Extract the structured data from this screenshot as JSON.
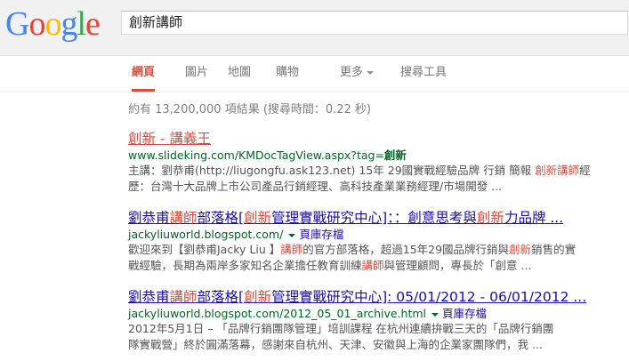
{
  "logo": {
    "letters": [
      {
        "ch": "G",
        "color": "#4285f4"
      },
      {
        "ch": "o",
        "color": "#ea4335"
      },
      {
        "ch": "o",
        "color": "#fbbc05"
      },
      {
        "ch": "g",
        "color": "#4285f4"
      },
      {
        "ch": "l",
        "color": "#34a853"
      },
      {
        "ch": "e",
        "color": "#ea4335"
      }
    ]
  },
  "search": {
    "query": "創新講師"
  },
  "tabs": [
    {
      "label": "網頁",
      "active": true
    },
    {
      "label": "圖片"
    },
    {
      "label": "地圖"
    },
    {
      "label": "購物"
    },
    {
      "label": "更多"
    },
    {
      "label": "搜尋工具"
    }
  ],
  "stats": "約有 13,200,000 項結果 (搜尋時間：0.22 秒)",
  "results": [
    {
      "title_parts": [
        [
          "創新",
          true
        ],
        [
          " - 講義王",
          false
        ]
      ],
      "url_parts": [
        [
          "www.slideking.com/KMDocTagView.aspx?tag=",
          false
        ],
        [
          "創新",
          true
        ]
      ],
      "cache": "",
      "snippet_lines": [
        [
          [
            "主講：劉恭甫(http://liugongfu.ask123.net) 15年 29國實戰經驗品牌 行銷 簡報 ",
            false
          ],
          [
            "創新講師",
            true
          ],
          [
            "經",
            false
          ]
        ],
        [
          [
            "歷：台灣十大品牌上市公司產品行銷經理、高科技產業業務經理/市場開發 ...",
            false
          ]
        ]
      ]
    },
    {
      "title_parts": [
        [
          "劉恭甫",
          false
        ],
        [
          "講師",
          true
        ],
        [
          "部落格[",
          false
        ],
        [
          "創新",
          true
        ],
        [
          "管理實戰研究中心]：：創意思考與",
          false
        ],
        [
          "創新",
          true
        ],
        [
          "力品牌 ...",
          false
        ]
      ],
      "url_parts": [
        [
          "jackyliuworld.blogspot.com/",
          false
        ]
      ],
      "cache": "頁庫存檔",
      "snippet_lines": [
        [
          [
            "歡迎來到【劉恭甫Jacky Liu 】",
            false
          ],
          [
            "講師",
            true
          ],
          [
            "的官方部落格，超過15年29國品牌行銷與",
            false
          ],
          [
            "創新",
            true
          ],
          [
            "銷售的實",
            false
          ]
        ],
        [
          [
            "戰經驗，長期為兩岸多家知名企業擔任教育訓練",
            false
          ],
          [
            "講師",
            true
          ],
          [
            "與管理顧問，專長於「創意 ...",
            false
          ]
        ]
      ]
    },
    {
      "title_parts": [
        [
          "劉恭甫",
          false
        ],
        [
          "講師",
          true
        ],
        [
          "部落格[",
          false
        ],
        [
          "創新",
          true
        ],
        [
          "管理實戰研究中心]: 05/01/2012 - 06/01/2012 ...",
          false
        ]
      ],
      "url_parts": [
        [
          "jackyliuworld.blogspot.com/2012_05_01_archive.html",
          false
        ]
      ],
      "cache": "頁庫存檔",
      "snippet_lines": [
        [
          [
            "2012年5月1日 – 「品牌行銷團隊管理」培訓課程 在杭州連續拚戰三天的「品牌行銷團",
            false
          ]
        ],
        [
          [
            "隊實戰營」終於圓滿落幕，感謝來自杭州、天津、安徽與上海的企業家團隊們，我 ...",
            false
          ]
        ]
      ]
    }
  ]
}
